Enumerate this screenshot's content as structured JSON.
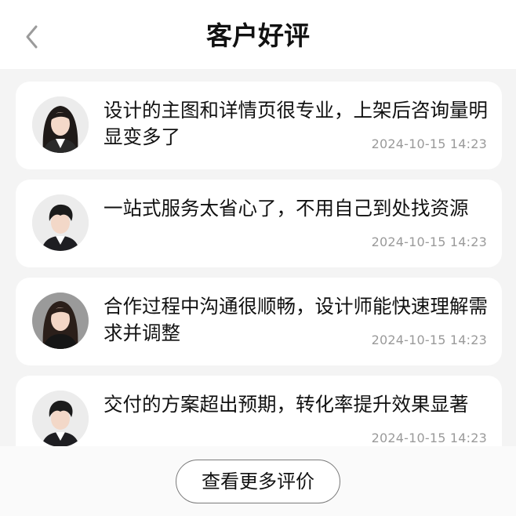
{
  "header": {
    "title": "客户好评",
    "back_icon": "chevron-left-icon"
  },
  "reviews": [
    {
      "text": "设计的主图和详情页很专业，上架后咨询量明显变多了",
      "time": "2024-10-15 14:23",
      "avatar": "female-avatar"
    },
    {
      "text": "一站式服务太省心了，不用自己到处找资源",
      "time": "2024-10-15 14:23",
      "avatar": "male-avatar"
    },
    {
      "text": "合作过程中沟通很顺畅，设计师能快速理解需求并调整",
      "time": "2024-10-15 14:23",
      "avatar": "female-avatar"
    },
    {
      "text": "交付的方案超出预期，转化率提升效果显著",
      "time": "2024-10-15 14:23",
      "avatar": "male-avatar"
    }
  ],
  "footer": {
    "more_label": "查看更多评价"
  },
  "colors": {
    "background": "#f4f4f4",
    "card": "#ffffff",
    "text": "#111111",
    "time": "#9a9a9a",
    "button_border": "#7a7a7a"
  }
}
